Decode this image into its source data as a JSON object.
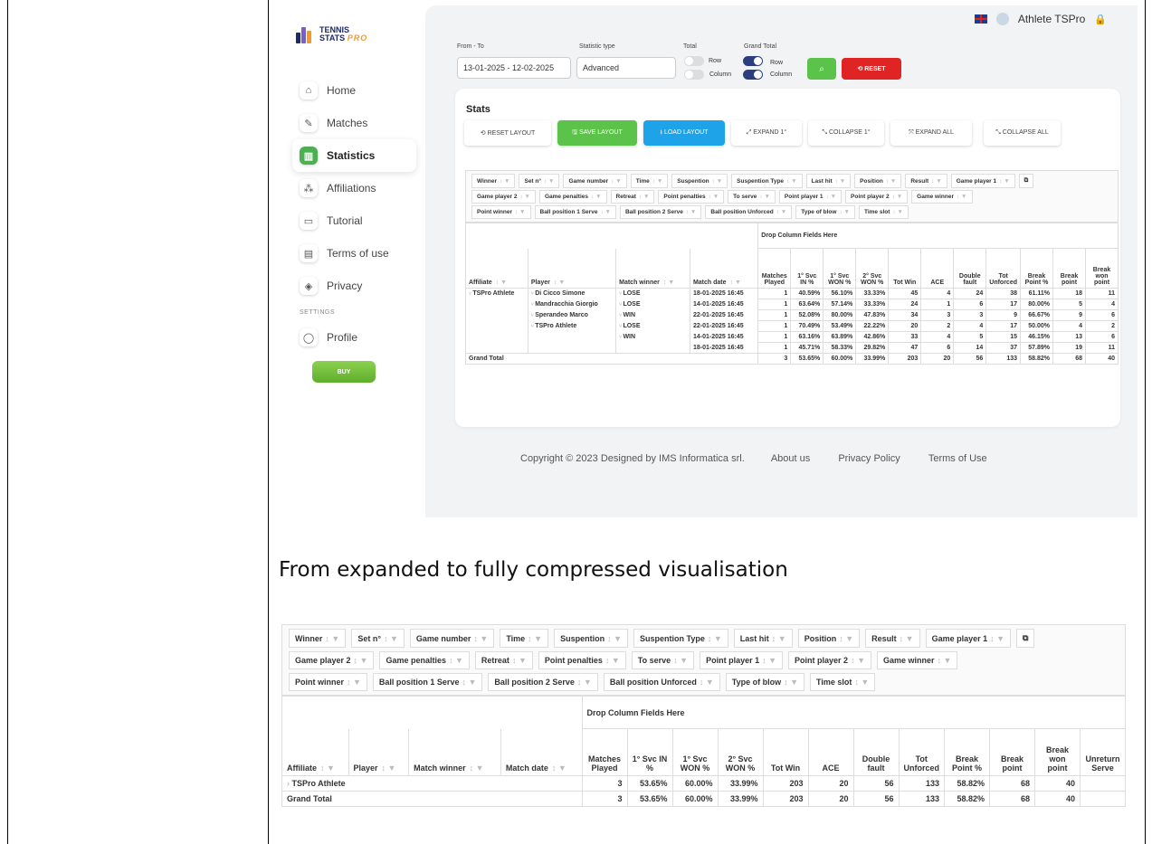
{
  "app": {
    "logo": {
      "line1": "TENNIS",
      "line2": "STATS",
      "line3": "PRO"
    },
    "nav": [
      {
        "label": "Home",
        "icon": "home-icon",
        "glyph": "⌂"
      },
      {
        "label": "Matches",
        "icon": "racket-icon",
        "glyph": "✎"
      },
      {
        "label": "Statistics",
        "icon": "chart-icon",
        "glyph": "▥"
      },
      {
        "label": "Affiliations",
        "icon": "network-icon",
        "glyph": "⁂"
      },
      {
        "label": "Tutorial",
        "icon": "monitor-icon",
        "glyph": "▭"
      },
      {
        "label": "Terms of use",
        "icon": "document-icon",
        "glyph": "▤"
      },
      {
        "label": "Privacy",
        "icon": "shield-icon",
        "glyph": "◈"
      }
    ],
    "settings_label": "SETTINGS",
    "profile": {
      "label": "Profile",
      "icon": "user-icon",
      "glyph": "◯"
    },
    "buy_label": "BUY",
    "user_name": "Athlete TSPro",
    "filters": {
      "from_to_label": "From - To",
      "from_to_value": "13-01-2025 - 12-02-2025",
      "statistic_type_label": "Statistic type",
      "statistic_type_value": "Advanced",
      "total_label": "Total",
      "grand_total_label": "Grand Total",
      "row_label": "Row",
      "column_label": "Column",
      "reset_label": "⟲ RESET",
      "search_glyph": "⌕"
    },
    "stats_title": "Stats",
    "layout_buttons": [
      "⟲ RESET LAYOUT",
      "🖫 SAVE LAYOUT",
      "⭳ LOAD LAYOUT",
      "⤢ EXPAND 1°",
      "⤡ COLLAPSE 1°",
      "⤧ EXPAND ALL",
      "⤡ COLLAPSE ALL"
    ],
    "footer": {
      "copyright": "Copyright © 2023 Designed by IMS Informatica srl.",
      "about": "About us",
      "privacy": "Privacy Policy",
      "terms": "Terms of Use"
    }
  },
  "pivot": {
    "field_rows": [
      [
        "Winner",
        "Set n°",
        "Game number",
        "Time",
        "Suspention",
        "Suspention Type",
        "Last hit",
        "Position",
        "Result",
        "Game player 1"
      ],
      [
        "Game player 2",
        "Game penalties",
        "Retreat",
        "Point penalties",
        "To serve",
        "Point player 1",
        "Point player 2",
        "Game winner"
      ],
      [
        "Point winner",
        "Ball position 1 Serve",
        "Ball position 2 Serve",
        "Ball position Unforced",
        "Type of blow",
        "Time slot"
      ]
    ],
    "drop_label": "Drop Column Fields Here",
    "row_headers": [
      "Affiliate",
      "Player",
      "Match winner",
      "Match date"
    ],
    "value_headers": [
      "Matches Played",
      "1° Svc IN %",
      "1° Svc WON %",
      "2° Svc WON %",
      "Tot Win",
      "ACE",
      "Double fault",
      "Tot Unforced",
      "Break Point %",
      "Break point",
      "Break won point"
    ],
    "value_headers_big": [
      "Matches Played",
      "1° Svc IN %",
      "1° Svc WON %",
      "2° Svc WON %",
      "Tot Win",
      "ACE",
      "Double fault",
      "Tot Unforced",
      "Break Point %",
      "Break point",
      "Break won point",
      "Unreturn Serve"
    ],
    "expanded_rows": [
      {
        "affiliate": "TSPro Athlete",
        "player": "Di Cicco Simone",
        "winner": "LOSE",
        "date": "18-01-2025 16:45",
        "v": [
          "1",
          "40.59%",
          "56.10%",
          "33.33%",
          "45",
          "4",
          "24",
          "38",
          "61.11%",
          "18",
          "11"
        ]
      },
      {
        "affiliate": "",
        "player": "Mandracchia Giorgio",
        "winner": "LOSE",
        "date": "14-01-2025 16:45",
        "v": [
          "1",
          "63.64%",
          "57.14%",
          "33.33%",
          "24",
          "1",
          "6",
          "17",
          "80.00%",
          "5",
          "4"
        ]
      },
      {
        "affiliate": "",
        "player": "Sperandeo Marco",
        "winner": "WIN",
        "date": "22-01-2025 16:45",
        "v": [
          "1",
          "52.08%",
          "80.00%",
          "47.83%",
          "34",
          "3",
          "3",
          "9",
          "66.67%",
          "9",
          "6"
        ]
      },
      {
        "affiliate": "",
        "player": "TSPro Athlete",
        "winner": "LOSE",
        "date": "22-01-2025 16:45",
        "v": [
          "1",
          "70.49%",
          "53.49%",
          "22.22%",
          "20",
          "2",
          "4",
          "17",
          "50.00%",
          "4",
          "2"
        ]
      },
      {
        "affiliate": "",
        "player": "",
        "winner": "WIN",
        "date": "14-01-2025 16:45",
        "v": [
          "1",
          "63.16%",
          "63.89%",
          "42.86%",
          "33",
          "4",
          "5",
          "15",
          "46.15%",
          "13",
          "6"
        ]
      },
      {
        "affiliate": "",
        "player": "",
        "winner": "",
        "date": "18-01-2025 16:45",
        "v": [
          "1",
          "45.71%",
          "58.33%",
          "29.82%",
          "47",
          "6",
          "14",
          "37",
          "57.89%",
          "19",
          "11"
        ]
      }
    ],
    "grand_total_label": "Grand Total",
    "grand_total_values": [
      "3",
      "53.65%",
      "60.00%",
      "33.99%",
      "203",
      "20",
      "56",
      "133",
      "58.82%",
      "68",
      "40"
    ],
    "collapsed_row": {
      "affiliate": "TSPro Athlete",
      "values": [
        "3",
        "53.65%",
        "60.00%",
        "33.99%",
        "203",
        "20",
        "56",
        "133",
        "58.82%",
        "68",
        "40",
        ""
      ]
    },
    "collapsed_grand_total_values": [
      "3",
      "53.65%",
      "60.00%",
      "33.99%",
      "203",
      "20",
      "56",
      "133",
      "58.82%",
      "68",
      "40",
      ""
    ]
  },
  "caption": "From expanded to fully compressed visualisation"
}
